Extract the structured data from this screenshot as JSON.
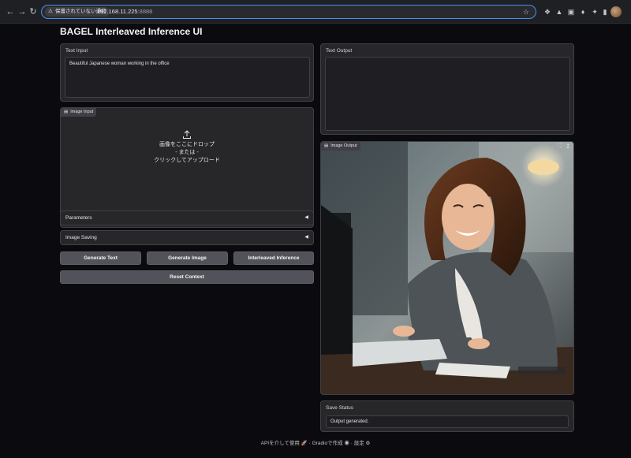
{
  "browser": {
    "security_label": "保護されていない通信",
    "url_host": "192.168.11.225",
    "url_port": ":8888"
  },
  "app": {
    "title": "BAGEL Interleaved Inference UI"
  },
  "text_input": {
    "label": "Text Input",
    "value": "Beautiful Japanese woman working in the office"
  },
  "image_input": {
    "label": "Image Input",
    "drop_text": "画像をここにドロップ",
    "or_text": "- または -",
    "click_text": "クリックしてアップロード"
  },
  "parameters": {
    "label": "Parameters"
  },
  "image_saving": {
    "label": "Image Saving"
  },
  "buttons": {
    "generate_text": "Generate Text",
    "generate_image": "Generate Image",
    "interleaved": "Interleaved Inference",
    "reset": "Reset Context"
  },
  "text_output": {
    "label": "Text Output",
    "value": ""
  },
  "image_output": {
    "label": "Image Output"
  },
  "save_status": {
    "label": "Save Status",
    "value": "Output generated."
  },
  "footer": {
    "api": "APIを介して使用",
    "gradio": "Gradioで作成",
    "settings": "設定",
    "sep": "·"
  },
  "colors": {
    "accent_focus": "#4c8df6",
    "upload_active": "#f97316",
    "panel_bg": "#27272a",
    "button_bg": "#52525b"
  }
}
